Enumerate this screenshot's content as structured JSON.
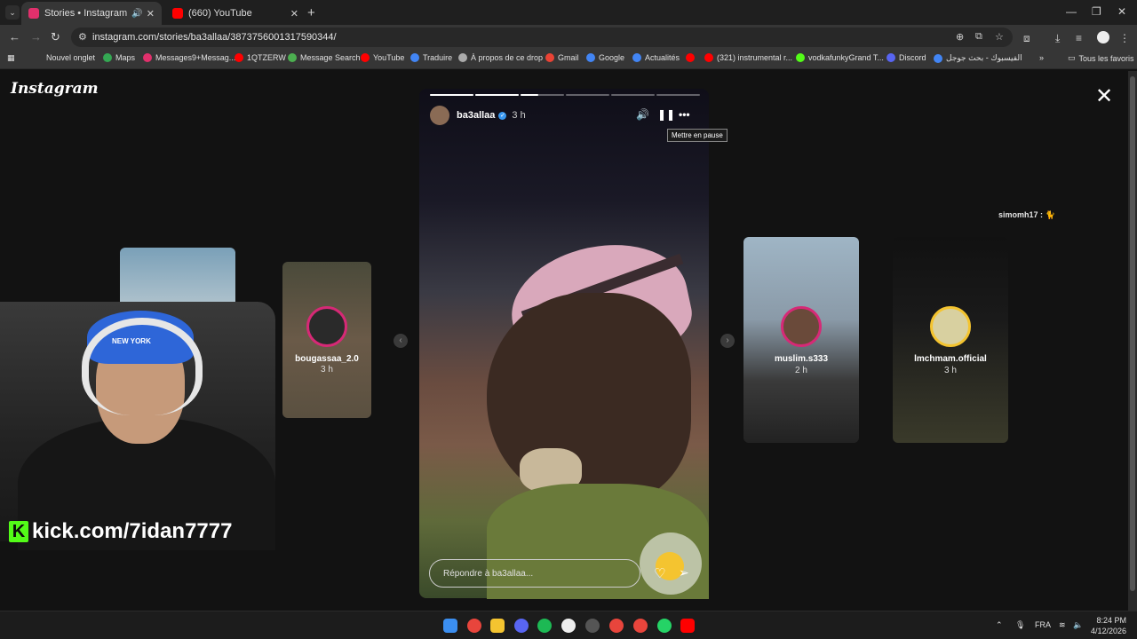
{
  "browser": {
    "tabs": [
      {
        "title": "Stories • Instagram",
        "active": true,
        "favicon_color": "#e1306c"
      },
      {
        "title": "(660) YouTube",
        "active": false,
        "favicon_color": "#ff0000"
      }
    ],
    "url": "instagram.com/stories/ba3allaa/3873756001317590344/",
    "bookmarks": [
      {
        "label": "Nouvel onglet",
        "color": "#888888"
      },
      {
        "label": "Maps",
        "color": "#34a853"
      },
      {
        "label": "Messages9+Messag...",
        "color": "#e1306c"
      },
      {
        "label": "1QTZERW",
        "color": "#ff0000"
      },
      {
        "label": "Message Search",
        "color": "#4caf50"
      },
      {
        "label": "YouTube",
        "color": "#ff0000"
      },
      {
        "label": "Traduire",
        "color": "#4285f4"
      },
      {
        "label": "À propos de ce drop",
        "color": "#aaaaaa"
      },
      {
        "label": "Gmail",
        "color": "#ea4335"
      },
      {
        "label": "Google",
        "color": "#4285f4"
      },
      {
        "label": "Actualités",
        "color": "#4285f4"
      },
      {
        "label": "",
        "color": "#ff0000"
      },
      {
        "label": "(321) instrumental r...",
        "color": "#ff0000"
      },
      {
        "label": "vodkafunkyGrand T...",
        "color": "#53fc18"
      },
      {
        "label": "Discord",
        "color": "#5865f2"
      },
      {
        "label": "الفيسبوك - بحث جوجل",
        "color": "#4285f4"
      }
    ],
    "all_bookmarks": "Tous les favoris"
  },
  "instagram": {
    "logo": "Instagram",
    "story": {
      "username": "ba3allaa",
      "age": "3 h",
      "progress": [
        1,
        1,
        0.4,
        0,
        0,
        0
      ],
      "tooltip": "Mettre en pause",
      "reply_placeholder": "Répondre à ba3allaa..."
    },
    "side_stories": [
      {
        "username": "",
        "age": ""
      },
      {
        "username": "bougassaa_2.0",
        "age": "3 h"
      },
      {
        "username": "muslim.s333",
        "age": "2 h"
      },
      {
        "username": "lmchmam.official",
        "age": "3 h"
      }
    ],
    "comment_tag": "simomh17 : 🐈"
  },
  "overlay": {
    "kick_text": "kick.com/7idan7777",
    "cap_text": "NEW YORK"
  },
  "taskbar": {
    "language": "FRA",
    "time": "8:24 PM",
    "date": "4/12/2026"
  }
}
